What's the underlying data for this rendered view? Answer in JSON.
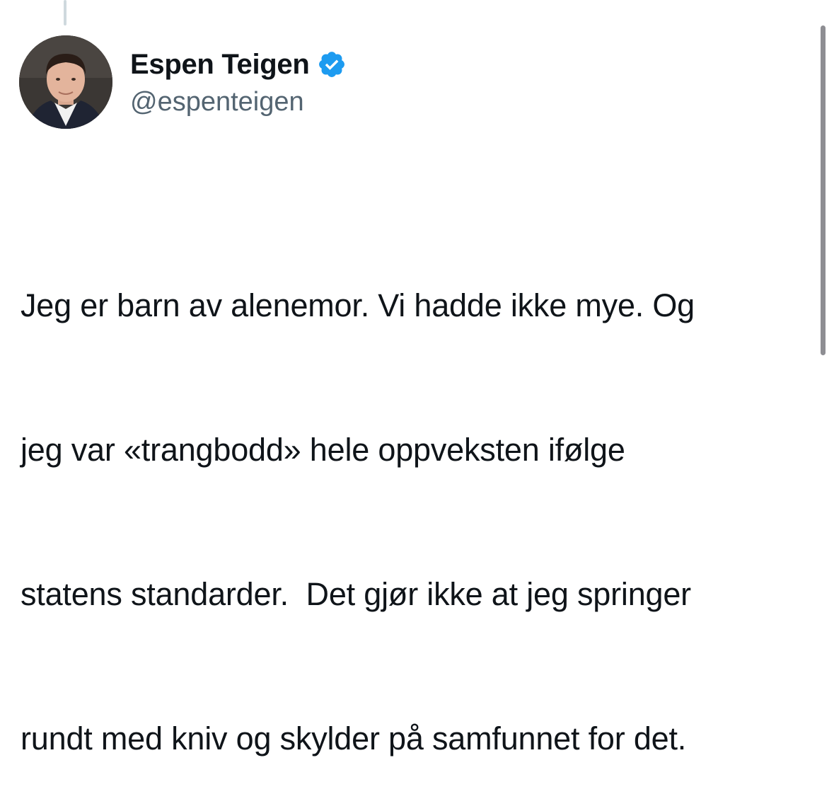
{
  "author": {
    "display_name": "Espen Teigen",
    "handle": "@espenteigen",
    "verified": true
  },
  "tweet": {
    "lines": [
      "Jeg er barn av alenemor. Vi hadde ikke mye. Og",
      "jeg var «trangbodd» hele oppveksten ifølge",
      "statens standarder.  Det gjør ikke at jeg springer",
      "rundt med kniv og skylder på samfunnet for det."
    ]
  },
  "colors": {
    "text": "#0f1419",
    "secondary_text": "#536471",
    "verified_badge": "#1d9bf0",
    "thread_line": "#cfd9de",
    "scrollbar": "#8e8e93"
  },
  "icons": {
    "verified": "verified-badge-icon",
    "avatar": "profile-photo"
  }
}
